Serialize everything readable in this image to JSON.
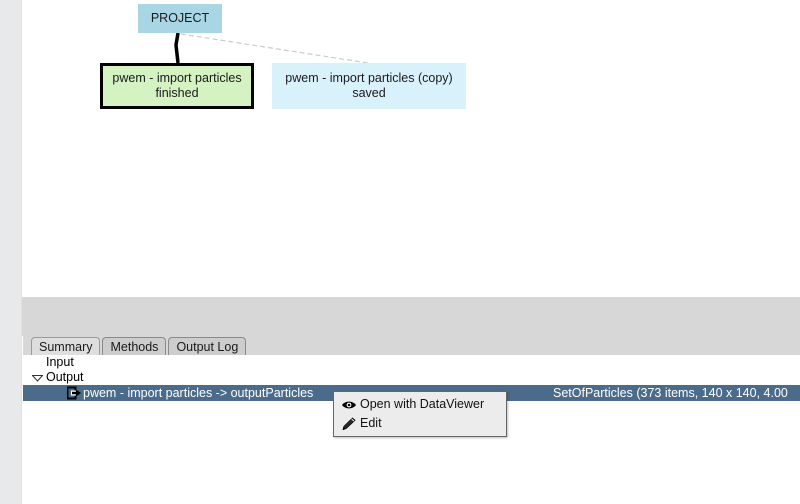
{
  "graph": {
    "nodes": [
      {
        "id": "project",
        "label": "PROJECT",
        "color": "#a9d6e4"
      },
      {
        "id": "import-particles",
        "label": "pwem - import particles\nfinished",
        "color": "#d4f2c2",
        "selected": true
      },
      {
        "id": "import-particles-copy",
        "label": "pwem - import particles (copy)\nsaved",
        "color": "#d9f1fb",
        "selected": false
      }
    ],
    "edges": [
      {
        "from": "project",
        "to": "import-particles",
        "style": "solid-thick"
      },
      {
        "from": "project",
        "to": "import-particles-copy",
        "style": "dashed-thin"
      }
    ]
  },
  "detail_panel": {
    "tabs": [
      {
        "id": "summary",
        "label": "Summary",
        "active": true
      },
      {
        "id": "methods",
        "label": "Methods",
        "active": false
      },
      {
        "id": "output-log",
        "label": "Output Log",
        "active": false
      }
    ],
    "tree": {
      "input": {
        "label": "Input"
      },
      "output": {
        "label": "Output",
        "twisty": "▽"
      },
      "selected_row": {
        "icon": "output-arrow-icon",
        "label": "pwem - import particles -> outputParticles",
        "info": "SetOfParticles (373 items, 140 x 140, 4.00"
      }
    }
  },
  "context_menu": {
    "items": [
      {
        "id": "open-with-dataviewer",
        "label": "Open with DataViewer",
        "icon": "eye-icon"
      },
      {
        "id": "edit",
        "label": "Edit",
        "icon": "pencil-icon"
      }
    ]
  },
  "colors": {
    "selection_blue": "#4a6b8a",
    "project_node": "#a9d6e4",
    "finished_node": "#d4f2c2",
    "saved_node": "#d9f1fb",
    "panel_gray": "#d7d7d7"
  }
}
